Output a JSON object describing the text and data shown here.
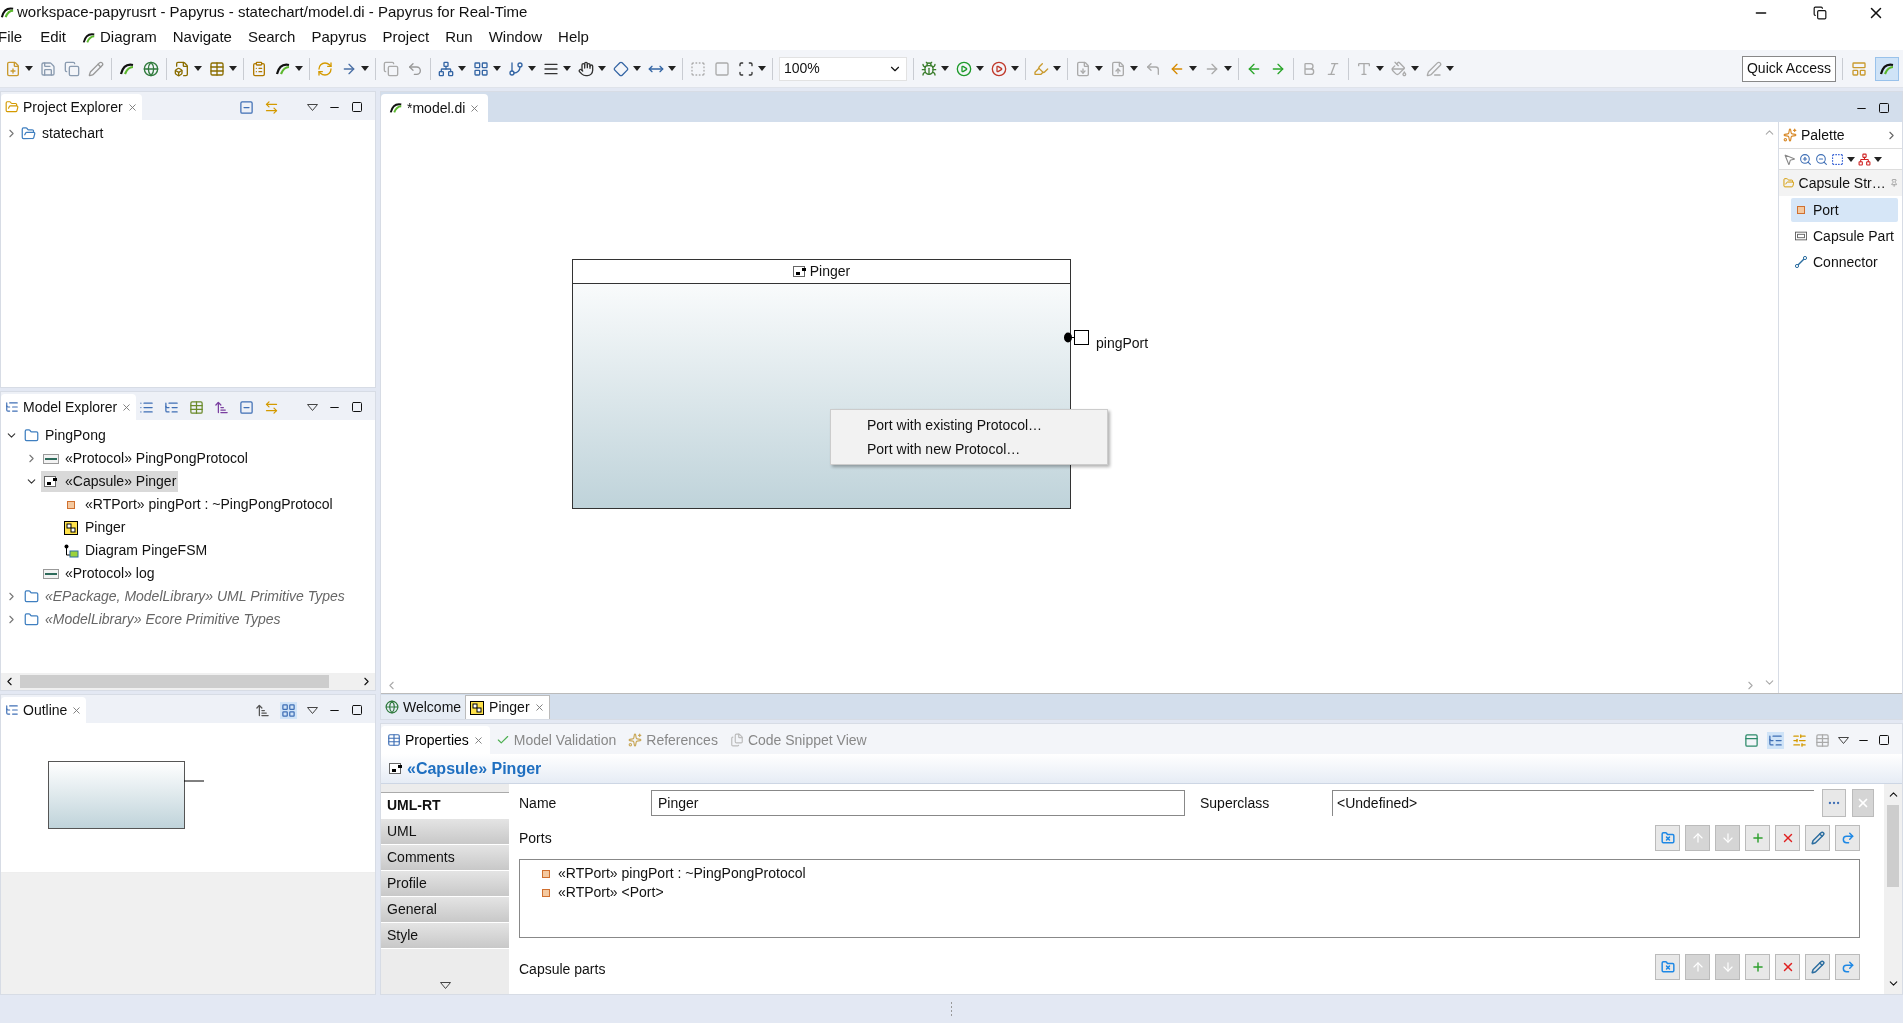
{
  "window": {
    "title": "workspace-papyrusrt - Papyrus - statechart/model.di - Papyrus for Real-Time"
  },
  "menu": [
    "File",
    "Edit",
    "Diagram",
    "Navigate",
    "Search",
    "Papyrus",
    "Project",
    "Run",
    "Window",
    "Help"
  ],
  "toolbar": {
    "zoom": "100%",
    "quick_access": "Quick Access"
  },
  "project_explorer": {
    "title": "Project Explorer",
    "items": [
      {
        "label": "statechart",
        "expanded": false
      }
    ]
  },
  "model_explorer": {
    "title": "Model Explorer",
    "items": [
      {
        "label": "PingPong",
        "kind": "package",
        "expanded": true,
        "selected": false,
        "children": [
          {
            "label": "«Protocol» PingPongProtocol",
            "kind": "protocol",
            "expanded": false,
            "selected": false
          },
          {
            "label": "«Capsule» Pinger",
            "kind": "capsule",
            "expanded": true,
            "selected": true,
            "children": [
              {
                "label": "«RTPort» pingPort : ~PingPongProtocol",
                "kind": "port",
                "selected": false
              },
              {
                "label": "Pinger",
                "kind": "diagram",
                "selected": false
              },
              {
                "label": "Diagram PingeFSM",
                "kind": "statemachine",
                "selected": false
              }
            ]
          },
          {
            "label": "«Protocol» log",
            "kind": "protocol",
            "selected": false
          }
        ]
      },
      {
        "label": "«EPackage, ModelLibrary» UML Primitive Types",
        "kind": "library",
        "expanded": false,
        "selected": false
      },
      {
        "label": "«ModelLibrary» Ecore Primitive Types",
        "kind": "library",
        "expanded": false,
        "selected": false
      }
    ]
  },
  "outline": {
    "title": "Outline"
  },
  "editor": {
    "tabs": [
      {
        "label": "*model.di",
        "selected": true
      }
    ],
    "capsule": {
      "name": "Pinger",
      "port": "pingPort"
    },
    "context_menu": [
      "Port with existing Protocol…",
      "Port with new Protocol…"
    ],
    "bottom_tabs": [
      {
        "label": "Welcome",
        "selected": false
      },
      {
        "label": "Pinger",
        "selected": true
      }
    ]
  },
  "palette": {
    "title": "Palette",
    "drawer": "Capsule Str…",
    "items": [
      {
        "label": "Port",
        "kind": "port",
        "selected": true
      },
      {
        "label": "Capsule Part",
        "kind": "part",
        "selected": false
      },
      {
        "label": "Connector",
        "kind": "connector",
        "selected": false
      }
    ]
  },
  "properties": {
    "tabs": [
      {
        "label": "Properties",
        "selected": true
      },
      {
        "label": "Model Validation",
        "selected": false
      },
      {
        "label": "References",
        "selected": false
      },
      {
        "label": "Code Snippet View",
        "selected": false
      }
    ],
    "heading": "«Capsule» Pinger",
    "sections": [
      {
        "label": "UML-RT",
        "selected": true
      },
      {
        "label": "UML",
        "selected": false
      },
      {
        "label": "Comments",
        "selected": false
      },
      {
        "label": "Profile",
        "selected": false
      },
      {
        "label": "General",
        "selected": false
      },
      {
        "label": "Style",
        "selected": false
      }
    ],
    "name_label": "Name",
    "name_value": "Pinger",
    "superclass_label": "Superclass",
    "superclass_value": "<Undefined>",
    "ports_label": "Ports",
    "ports": [
      "«RTPort» pingPort : ~PingPongProtocol",
      "«RTPort» <Port>"
    ],
    "capsule_parts_label": "Capsule parts"
  }
}
